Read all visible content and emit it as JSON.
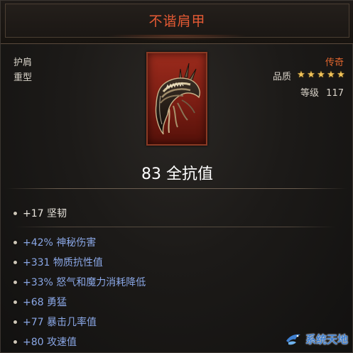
{
  "item": {
    "name": "不谐肩甲",
    "slot": "护肩",
    "weight_class": "重型",
    "rarity": "传奇",
    "quality_label": "品质",
    "quality_stars": 5,
    "level_label": "等级",
    "level_value": "117",
    "main_stat": "83 全抗值"
  },
  "affixes": {
    "primary": "+17 坚韧",
    "list": [
      "+42% 神秘伤害",
      "+331 物质抗性值",
      "+33% 怒气和魔力消耗降低",
      "+68 勇猛",
      "+77 暴击几率值",
      "+80 攻速值"
    ]
  },
  "watermark": {
    "text": "系统天地"
  },
  "colors": {
    "title": "#e55a34",
    "rarity": "#e1662e",
    "affix_blue": "#8aa7e6",
    "star": "#f2c45a",
    "card_bg": "#8c2418"
  },
  "icons": {
    "item": "shoulder-armor-icon",
    "star": "star-icon",
    "bullet": "bullet-icon",
    "watermark": "bird-logo-icon"
  }
}
